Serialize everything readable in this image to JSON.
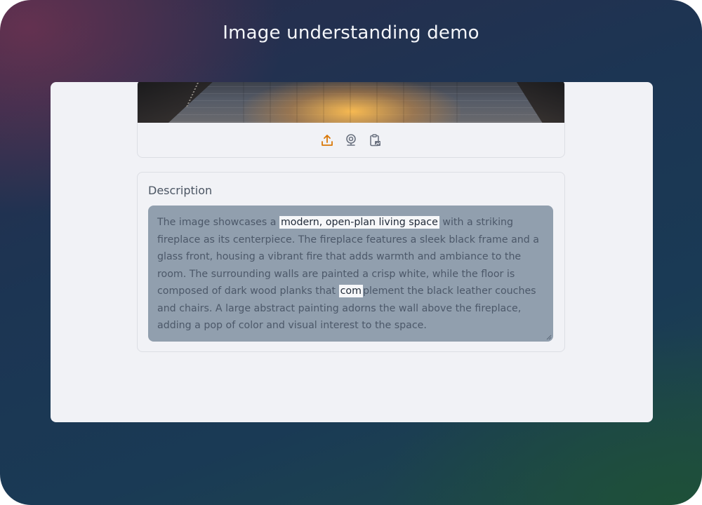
{
  "app": {
    "title": "Image understanding demo"
  },
  "image_input": {
    "toolbar": [
      {
        "icon": "upload-icon",
        "color": "#d97706"
      },
      {
        "icon": "webcam-icon",
        "color": "#6b7280"
      },
      {
        "icon": "clipboard-paste-icon",
        "color": "#6b7280"
      }
    ]
  },
  "description": {
    "label": "Description",
    "text_parts": [
      "The image showcases a ",
      "modern, open-plan living space",
      " with a striking fireplace as its centerpiece. The fireplace features a sleek black frame and a glass front, housing a vibrant fire that adds warmth and ambiance to the room. The surrounding walls are painted a crisp white, while the floor is composed of dark wood planks that ",
      "com",
      "plement the black leather couches and chairs. A large abstract painting adorns the wall above the fireplace, adding a pop of color and visual interest to the space."
    ]
  },
  "colors": {
    "panel_bg": "#f1f2f6",
    "textarea_bg": "#919fae",
    "accent": "#d97706"
  }
}
